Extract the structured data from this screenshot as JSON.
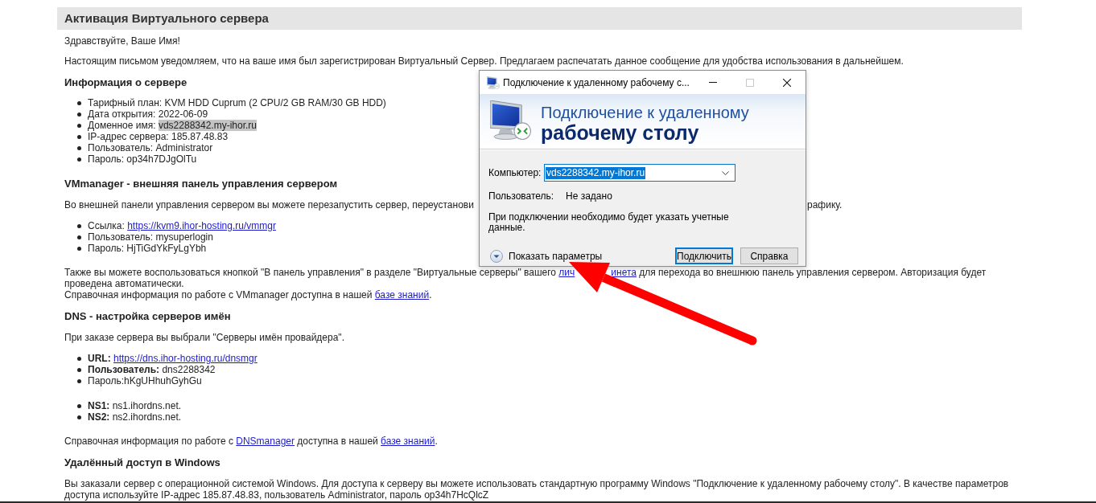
{
  "page": {
    "title": "Активация Виртуального сервера",
    "blocks": [
      {
        "kind": "paragraph",
        "lines": [
          [
            {
              "kind": "text",
              "text": "Здравствуйте, Ваше Имя!"
            }
          ]
        ]
      },
      {
        "kind": "paragraph",
        "lines": [
          [
            {
              "kind": "text",
              "text": "Настоящим письмом уведомляем, что на ваше имя был зарегистрирован Виртуальный Сервер. Предлагаем распечатать данное сообщение для удобства использования в дальнейшем."
            }
          ]
        ]
      },
      {
        "kind": "heading",
        "text": "Информация о сервере"
      },
      {
        "kind": "list",
        "items": [
          {
            "label": "Тарифный план:",
            "bold": false,
            "value": "KVM HDD Cuprum (2 CPU/2 GB RAM/30 GB HDD)",
            "link": false,
            "highlighted": false
          },
          {
            "label": "Дата открытия:",
            "bold": false,
            "value": "2022-06-09",
            "link": false,
            "highlighted": false
          },
          {
            "label": "Доменное имя:",
            "bold": false,
            "value": "vds2288342.my-ihor.ru",
            "link": false,
            "highlighted": true
          },
          {
            "label": "IP-адрес сервера:",
            "bold": false,
            "value": "185.87.48.83",
            "link": false,
            "highlighted": false
          },
          {
            "label": "Пользователь:",
            "bold": false,
            "value": "Administrator",
            "link": false,
            "highlighted": false
          },
          {
            "label": "Пароль:",
            "bold": false,
            "value": "op34h7DJgOlTu",
            "link": false,
            "highlighted": false
          }
        ]
      },
      {
        "kind": "heading",
        "text": "VMmanager - внешняя панель управления сервером"
      },
      {
        "kind": "paragraph",
        "lines": [
          [
            {
              "kind": "text",
              "text": "Во внешней панели управления сервером вы можете перезапустить сервер, переустанови"
            },
            {
              "kind": "text",
              "text": "рафику.",
              "after_dialog": true
            }
          ]
        ]
      },
      {
        "kind": "list",
        "items": [
          {
            "label": "Ссылка:",
            "bold": false,
            "value": "https://kvm9.ihor-hosting.ru/vmmgr",
            "link": true,
            "highlighted": false
          },
          {
            "label": "Пользователь:",
            "bold": false,
            "value": "mysuperlogin",
            "link": false,
            "highlighted": false
          },
          {
            "label": "Пароль:",
            "bold": false,
            "value": "HjTiGdYkFyLgYbh",
            "link": false,
            "highlighted": false
          }
        ]
      },
      {
        "kind": "paragraph",
        "lines": [
          [
            {
              "kind": "text",
              "text": "Также вы можете воспользоваться кнопкой \"В панель управления\" в разделе \"Виртуальные серверы\" вашего "
            },
            {
              "kind": "link",
              "text": "лич"
            },
            {
              "kind": "link",
              "text": "инета",
              "after_arrow": true
            },
            {
              "kind": "text",
              "text": " для перехода во внешнюю панель управления сервером. Авторизация будет"
            }
          ],
          [
            {
              "kind": "text",
              "text": "проведена автоматически."
            }
          ],
          [
            {
              "kind": "text",
              "text": "Справочная информация по работе с VMmanager доступна в нашей "
            },
            {
              "kind": "link",
              "text": "базе знаний"
            },
            {
              "kind": "text",
              "text": "."
            }
          ]
        ]
      },
      {
        "kind": "heading",
        "text": "DNS - настройка серверов имён"
      },
      {
        "kind": "paragraph",
        "lines": [
          [
            {
              "kind": "text",
              "text": "При заказе сервера вы выбрали \"Серверы имён провайдера\"."
            }
          ]
        ]
      },
      {
        "kind": "list",
        "items": [
          {
            "label": "URL:",
            "bold": true,
            "value": "https://dns.ihor-hosting.ru/dnsmgr",
            "link": true,
            "highlighted": false
          },
          {
            "label": "Пользователь:",
            "bold": true,
            "value": "dns2288342",
            "link": false,
            "highlighted": false
          },
          {
            "label": "Пароль:hKgUHhuhGyhGu",
            "bold": false
          }
        ]
      },
      {
        "kind": "list",
        "items": [
          {
            "label": "NS1:",
            "bold": true,
            "value": "ns1.ihordns.net.",
            "link": false,
            "highlighted": false
          },
          {
            "label": "NS2:",
            "bold": true,
            "value": "ns2.ihordns.net.",
            "link": false,
            "highlighted": false
          }
        ]
      },
      {
        "kind": "paragraph",
        "lines": [
          [
            {
              "kind": "text",
              "text": "Справочная информация по работе с "
            },
            {
              "kind": "link",
              "text": "DNSmanager"
            },
            {
              "kind": "text",
              "text": " доступна в нашей "
            },
            {
              "kind": "link",
              "text": "базе знаний"
            },
            {
              "kind": "text",
              "text": "."
            }
          ]
        ]
      },
      {
        "kind": "heading",
        "text": "Удалённый доступ в Windows"
      },
      {
        "kind": "paragraph",
        "lines": [
          [
            {
              "kind": "text",
              "text": "Вы заказали сервер с операционной системой Windows. Для доступа к серверу вы можете использовать стандартную программу Windows \"Подключение к удаленному рабочему столу\". В качестве параметров"
            }
          ],
          [
            {
              "kind": "text",
              "text": "доступа используйте IP-адрес 185.87.48.83, пользователь Administrator, пароль op34h7HcQlcZ"
            }
          ]
        ]
      }
    ]
  },
  "dialog": {
    "title": "Подключение к удаленному рабочему с...",
    "window_controls": [
      {
        "kind": "minimize",
        "disabled": false
      },
      {
        "kind": "maximize",
        "disabled": true
      },
      {
        "kind": "close",
        "disabled": false
      }
    ],
    "banner": {
      "line_1": "Подключение к удаленному",
      "line_2": "рабочему столу"
    },
    "computer": {
      "label": "Компьютер:",
      "value": "vds2288342.my-ihor.ru",
      "text_selected": true
    },
    "user": {
      "label": "Пользователь:",
      "value": "Не задано"
    },
    "note": "При подключении необходимо будет указать учетные данные.",
    "options_toggle": {
      "label": "Показать параметры",
      "expanded": false
    },
    "buttons": [
      {
        "label": "Подключить",
        "default": true
      },
      {
        "label": "Справка",
        "default": false
      }
    ]
  }
}
